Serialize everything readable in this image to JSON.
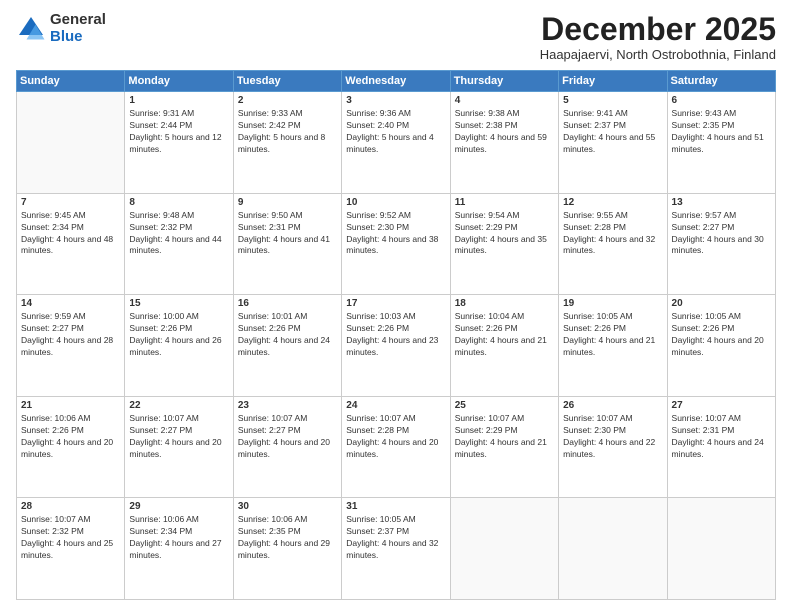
{
  "logo": {
    "general": "General",
    "blue": "Blue"
  },
  "title": "December 2025",
  "subtitle": "Haapajaervi, North Ostrobothnia, Finland",
  "days_header": [
    "Sunday",
    "Monday",
    "Tuesday",
    "Wednesday",
    "Thursday",
    "Friday",
    "Saturday"
  ],
  "weeks": [
    [
      {
        "day": "",
        "sunrise": "",
        "sunset": "",
        "daylight": ""
      },
      {
        "day": "1",
        "sunrise": "9:31 AM",
        "sunset": "2:44 PM",
        "daylight": "5 hours and 12 minutes."
      },
      {
        "day": "2",
        "sunrise": "9:33 AM",
        "sunset": "2:42 PM",
        "daylight": "5 hours and 8 minutes."
      },
      {
        "day": "3",
        "sunrise": "9:36 AM",
        "sunset": "2:40 PM",
        "daylight": "5 hours and 4 minutes."
      },
      {
        "day": "4",
        "sunrise": "9:38 AM",
        "sunset": "2:38 PM",
        "daylight": "4 hours and 59 minutes."
      },
      {
        "day": "5",
        "sunrise": "9:41 AM",
        "sunset": "2:37 PM",
        "daylight": "4 hours and 55 minutes."
      },
      {
        "day": "6",
        "sunrise": "9:43 AM",
        "sunset": "2:35 PM",
        "daylight": "4 hours and 51 minutes."
      }
    ],
    [
      {
        "day": "7",
        "sunrise": "9:45 AM",
        "sunset": "2:34 PM",
        "daylight": "4 hours and 48 minutes."
      },
      {
        "day": "8",
        "sunrise": "9:48 AM",
        "sunset": "2:32 PM",
        "daylight": "4 hours and 44 minutes."
      },
      {
        "day": "9",
        "sunrise": "9:50 AM",
        "sunset": "2:31 PM",
        "daylight": "4 hours and 41 minutes."
      },
      {
        "day": "10",
        "sunrise": "9:52 AM",
        "sunset": "2:30 PM",
        "daylight": "4 hours and 38 minutes."
      },
      {
        "day": "11",
        "sunrise": "9:54 AM",
        "sunset": "2:29 PM",
        "daylight": "4 hours and 35 minutes."
      },
      {
        "day": "12",
        "sunrise": "9:55 AM",
        "sunset": "2:28 PM",
        "daylight": "4 hours and 32 minutes."
      },
      {
        "day": "13",
        "sunrise": "9:57 AM",
        "sunset": "2:27 PM",
        "daylight": "4 hours and 30 minutes."
      }
    ],
    [
      {
        "day": "14",
        "sunrise": "9:59 AM",
        "sunset": "2:27 PM",
        "daylight": "4 hours and 28 minutes."
      },
      {
        "day": "15",
        "sunrise": "10:00 AM",
        "sunset": "2:26 PM",
        "daylight": "4 hours and 26 minutes."
      },
      {
        "day": "16",
        "sunrise": "10:01 AM",
        "sunset": "2:26 PM",
        "daylight": "4 hours and 24 minutes."
      },
      {
        "day": "17",
        "sunrise": "10:03 AM",
        "sunset": "2:26 PM",
        "daylight": "4 hours and 23 minutes."
      },
      {
        "day": "18",
        "sunrise": "10:04 AM",
        "sunset": "2:26 PM",
        "daylight": "4 hours and 21 minutes."
      },
      {
        "day": "19",
        "sunrise": "10:05 AM",
        "sunset": "2:26 PM",
        "daylight": "4 hours and 21 minutes."
      },
      {
        "day": "20",
        "sunrise": "10:05 AM",
        "sunset": "2:26 PM",
        "daylight": "4 hours and 20 minutes."
      }
    ],
    [
      {
        "day": "21",
        "sunrise": "10:06 AM",
        "sunset": "2:26 PM",
        "daylight": "4 hours and 20 minutes."
      },
      {
        "day": "22",
        "sunrise": "10:07 AM",
        "sunset": "2:27 PM",
        "daylight": "4 hours and 20 minutes."
      },
      {
        "day": "23",
        "sunrise": "10:07 AM",
        "sunset": "2:27 PM",
        "daylight": "4 hours and 20 minutes."
      },
      {
        "day": "24",
        "sunrise": "10:07 AM",
        "sunset": "2:28 PM",
        "daylight": "4 hours and 20 minutes."
      },
      {
        "day": "25",
        "sunrise": "10:07 AM",
        "sunset": "2:29 PM",
        "daylight": "4 hours and 21 minutes."
      },
      {
        "day": "26",
        "sunrise": "10:07 AM",
        "sunset": "2:30 PM",
        "daylight": "4 hours and 22 minutes."
      },
      {
        "day": "27",
        "sunrise": "10:07 AM",
        "sunset": "2:31 PM",
        "daylight": "4 hours and 24 minutes."
      }
    ],
    [
      {
        "day": "28",
        "sunrise": "10:07 AM",
        "sunset": "2:32 PM",
        "daylight": "4 hours and 25 minutes."
      },
      {
        "day": "29",
        "sunrise": "10:06 AM",
        "sunset": "2:34 PM",
        "daylight": "4 hours and 27 minutes."
      },
      {
        "day": "30",
        "sunrise": "10:06 AM",
        "sunset": "2:35 PM",
        "daylight": "4 hours and 29 minutes."
      },
      {
        "day": "31",
        "sunrise": "10:05 AM",
        "sunset": "2:37 PM",
        "daylight": "4 hours and 32 minutes."
      },
      {
        "day": "",
        "sunrise": "",
        "sunset": "",
        "daylight": ""
      },
      {
        "day": "",
        "sunrise": "",
        "sunset": "",
        "daylight": ""
      },
      {
        "day": "",
        "sunrise": "",
        "sunset": "",
        "daylight": ""
      }
    ]
  ],
  "labels": {
    "sunrise_prefix": "Sunrise: ",
    "sunset_prefix": "Sunset: ",
    "daylight_prefix": "Daylight: "
  }
}
